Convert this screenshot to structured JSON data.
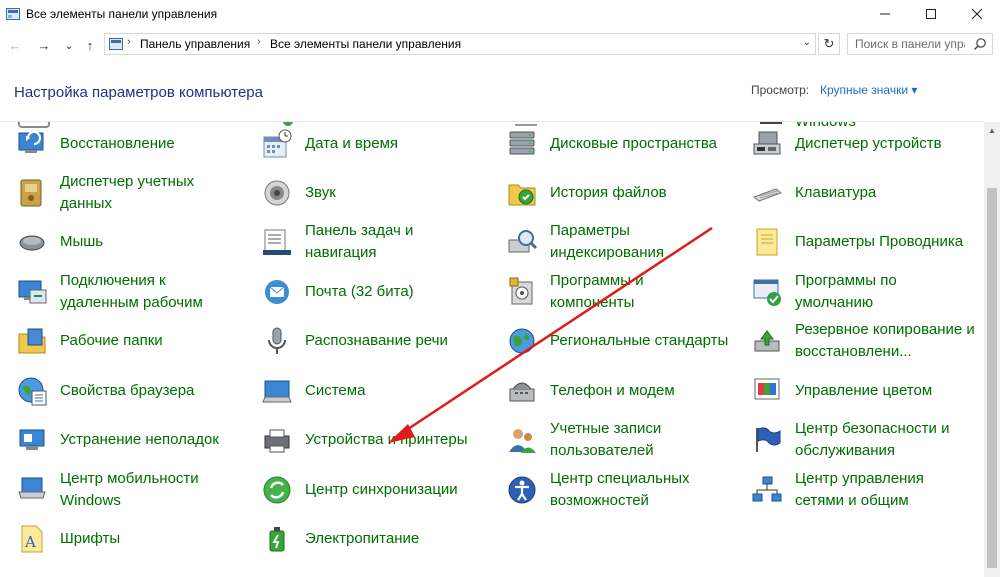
{
  "window": {
    "title": "Все элементы панели управления",
    "controls": {
      "minimize": "—",
      "maximize": "☐",
      "close": "✕"
    }
  },
  "nav": {
    "back": "←",
    "forward": "→",
    "recent": "⌄",
    "up": "↑",
    "refresh": "↻",
    "breadcrumb": [
      "Панель управления",
      "Все элементы панели управления"
    ],
    "breadcrumb_sep": "›",
    "search_placeholder": "Поиск в панели упра..."
  },
  "header": {
    "title": "Настройка параметров компьютера",
    "view_label": "Просмотр:",
    "view_value": "Крупные значки",
    "view_caret": "▾"
  },
  "cut_row": {
    "col4_text": "Windows"
  },
  "items": [
    {
      "label": "Восстановление",
      "icon": "recovery-icon"
    },
    {
      "label": "Дата и время",
      "icon": "date-time-icon"
    },
    {
      "label": "Дисковые пространства",
      "icon": "storage-spaces-icon"
    },
    {
      "label": "Диспетчер устройств",
      "icon": "device-manager-icon"
    },
    {
      "label": "Диспетчер учетных данных",
      "icon": "credential-manager-icon"
    },
    {
      "label": "Звук",
      "icon": "sound-icon"
    },
    {
      "label": "История файлов",
      "icon": "file-history-icon"
    },
    {
      "label": "Клавиатура",
      "icon": "keyboard-icon"
    },
    {
      "label": "Мышь",
      "icon": "mouse-icon"
    },
    {
      "label": "Панель задач и навигация",
      "icon": "taskbar-icon"
    },
    {
      "label": "Параметры индексирования",
      "icon": "indexing-icon"
    },
    {
      "label": "Параметры Проводника",
      "icon": "folder-options-icon"
    },
    {
      "label": "Подключения к удаленным рабочим",
      "icon": "remote-desktop-icon"
    },
    {
      "label": "Почта (32 бита)",
      "icon": "mail-icon"
    },
    {
      "label": "Программы и компоненты",
      "icon": "programs-icon"
    },
    {
      "label": "Программы по умолчанию",
      "icon": "default-programs-icon"
    },
    {
      "label": "Рабочие папки",
      "icon": "work-folders-icon"
    },
    {
      "label": "Распознавание речи",
      "icon": "speech-icon"
    },
    {
      "label": "Региональные стандарты",
      "icon": "region-icon"
    },
    {
      "label": "Резервное копирование и восстановлени...",
      "icon": "backup-icon"
    },
    {
      "label": "Свойства браузера",
      "icon": "internet-options-icon"
    },
    {
      "label": "Система",
      "icon": "system-icon"
    },
    {
      "label": "Телефон и модем",
      "icon": "phone-modem-icon"
    },
    {
      "label": "Управление цветом",
      "icon": "color-management-icon"
    },
    {
      "label": "Устранение неполадок",
      "icon": "troubleshooting-icon"
    },
    {
      "label": "Устройства и принтеры",
      "icon": "devices-printers-icon"
    },
    {
      "label": "Учетные записи пользователей",
      "icon": "user-accounts-icon"
    },
    {
      "label": "Центр безопасности и обслуживания",
      "icon": "security-center-icon"
    },
    {
      "label": "Центр мобильности Windows",
      "icon": "mobility-center-icon"
    },
    {
      "label": "Центр синхронизации",
      "icon": "sync-center-icon"
    },
    {
      "label": "Центр специальных возможностей",
      "icon": "ease-of-access-icon"
    },
    {
      "label": "Центр управления сетями и общим",
      "icon": "network-center-icon"
    },
    {
      "label": "Шрифты",
      "icon": "fonts-icon"
    },
    {
      "label": "Электропитание",
      "icon": "power-options-icon"
    }
  ],
  "colors": {
    "item_text": "#006e00",
    "heading": "#1e3287",
    "link": "#1e6bd0",
    "annotation_arrow": "#e01b1b"
  }
}
